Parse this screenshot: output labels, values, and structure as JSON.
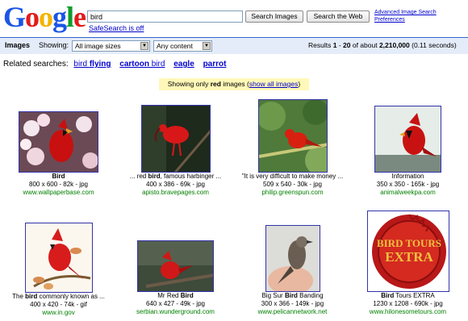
{
  "header": {
    "logo_letters": [
      "G",
      "o",
      "o",
      "g",
      "l",
      "e"
    ],
    "logo_colors": [
      "#1a55e6",
      "#e31b1b",
      "#f5b400",
      "#1a55e6",
      "#0f9d2e",
      "#e31b1b"
    ],
    "search_value": "bird",
    "search_images_label": "Search Images",
    "search_web_label": "Search the Web",
    "advanced_link": "Advanced Image Search",
    "preferences_link": "Preferences",
    "safesearch_link": "SafeSearch is off"
  },
  "bar": {
    "title": "Images",
    "showing_label": "Showing:",
    "size_select": "All image sizes",
    "content_select": "Any content",
    "results_prefix": "Results ",
    "results_range_start": "1",
    "results_dash": " - ",
    "results_range_end": "20",
    "results_middle": " of about ",
    "results_total": "2,210,000",
    "results_time": " (0.11 seconds)"
  },
  "related": {
    "label": "Related searches:",
    "items": [
      {
        "plain": "bird ",
        "bold": "flying"
      },
      {
        "plain": "",
        "bold": "cartoon",
        "plain2": " bird"
      },
      {
        "plain": "",
        "bold": "eagle"
      },
      {
        "plain": "",
        "bold": "parrot"
      }
    ]
  },
  "notice": {
    "prefix": "Showing only ",
    "bold": "red",
    "middle": " images (",
    "link": "show all images",
    "suffix": ")"
  },
  "results": [
    {
      "cap_pre": "",
      "cap_bold": "Bird",
      "cap_post": "",
      "meta": "800 x 600 - 82k - jpg",
      "url": "www.wallpaperbase.com"
    },
    {
      "cap_pre": "... red ",
      "cap_bold": "bird",
      "cap_post": ", famous harbinger ...",
      "meta": "400 x 386 - 69k - jpg",
      "url": "apisto.bravepages.com"
    },
    {
      "cap_pre": "\"It is very difficult to make money ...",
      "cap_bold": "",
      "cap_post": "",
      "meta": "509 x 540 - 30k - jpg",
      "url": "philip.greenspun.com"
    },
    {
      "cap_pre": "Information",
      "cap_bold": "",
      "cap_post": "",
      "meta": "350 x 350 - 165k - jpg",
      "url": "animalweekpa.com"
    },
    {
      "cap_pre": "The ",
      "cap_bold": "bird",
      "cap_post": " commonly known as ...",
      "meta": "400 x 420 - 74k - gif",
      "url": "www.in.gov"
    },
    {
      "cap_pre": "Mr Red ",
      "cap_bold": "Bird",
      "cap_post": "",
      "meta": "640 x 427 - 49k - jpg",
      "url": "serbian.wunderground.com"
    },
    {
      "cap_pre": "Big Sur ",
      "cap_bold": "Bird",
      "cap_post": " Banding",
      "meta": "300 x 366 - 149k - jpg",
      "url": "www.pelicannetwork.net"
    },
    {
      "cap_pre": "",
      "cap_bold": "Bird",
      "cap_post": " Tours EXTRA",
      "meta": "1230 x 1208 - 690k - jpg",
      "url": "www.hilonesometours.com"
    }
  ],
  "seal": {
    "line1": "BIRD TOURS",
    "line2": "EXTRA"
  }
}
